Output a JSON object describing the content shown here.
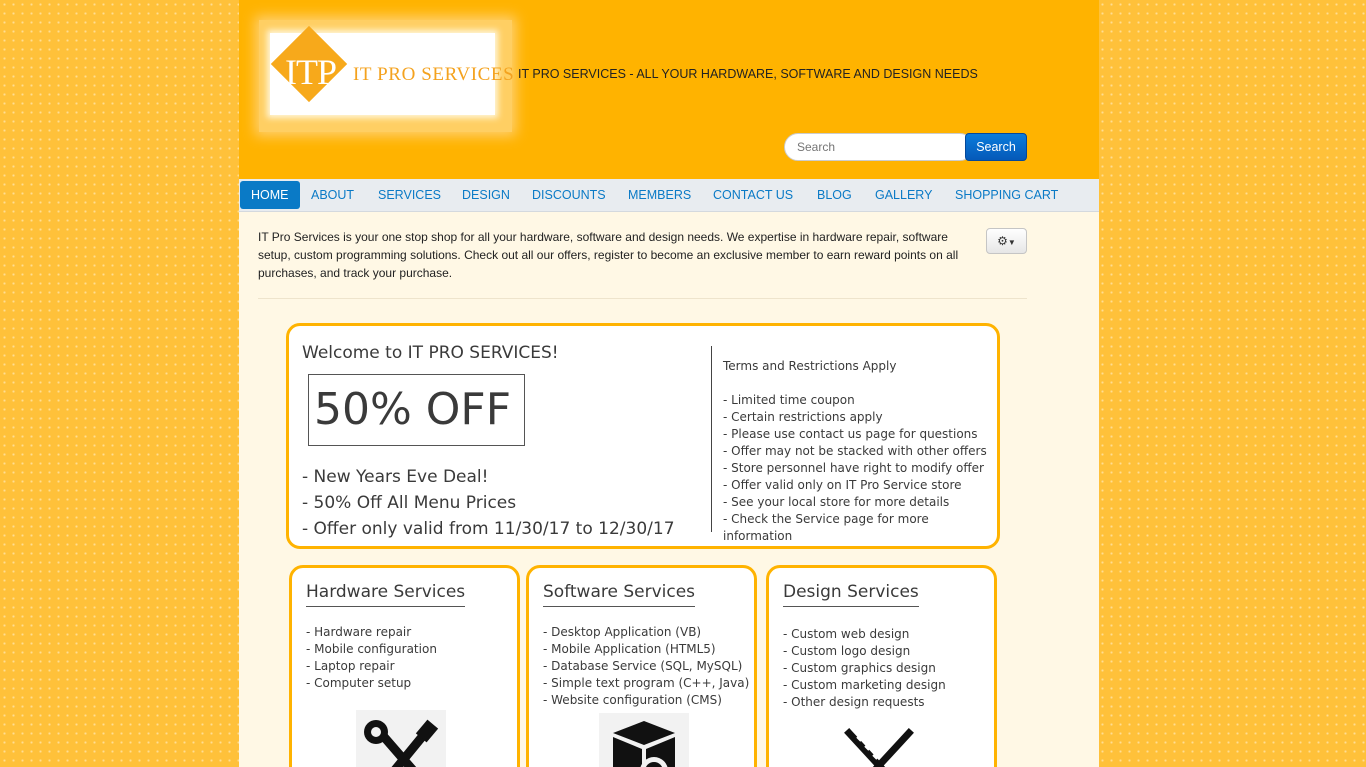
{
  "header": {
    "logo_itp": "ITP",
    "logo_name": "IT PRO SERVICES",
    "tagline": "IT PRO SERVICES - ALL YOUR HARDWARE, SOFTWARE AND DESIGN NEEDS",
    "search_placeholder": "Search",
    "search_button": "Search"
  },
  "nav": {
    "items": [
      {
        "label": "HOME",
        "active": true
      },
      {
        "label": "ABOUT"
      },
      {
        "label": "SERVICES"
      },
      {
        "label": "DESIGN"
      },
      {
        "label": "DISCOUNTS"
      },
      {
        "label": "MEMBERS"
      },
      {
        "label": "CONTACT US"
      },
      {
        "label": "BLOG"
      },
      {
        "label": "GALLERY"
      },
      {
        "label": "SHOPPING CART"
      }
    ]
  },
  "intro": {
    "text": "IT Pro Services is your one stop shop for all your hardware, software and design needs. We expertise in hardware repair, software setup, custom programming solutions. Check out all our offers, register to become an exclusive member to earn reward points on all purchases, and track your purchase.",
    "gear_icon": "gear-icon"
  },
  "promo": {
    "welcome": "Welcome to IT PRO SERVICES!",
    "discount": "50% OFF",
    "deal_lines": [
      "- New Years Eve Deal!",
      "- 50% Off All Menu Prices",
      "- Offer only valid from 11/30/17 to 12/30/17"
    ],
    "terms_title": "Terms and Restrictions Apply",
    "terms": [
      "- Limited time coupon",
      "- Certain restrictions apply",
      "- Please use contact us page for questions",
      "- Offer may not be stacked with other offers",
      "- Store personnel have right to modify offer",
      "- Offer valid only on IT Pro Service store",
      "- See your local store for more details",
      "- Check the Service page for more information"
    ]
  },
  "services": [
    {
      "title": "Hardware Services",
      "items": [
        "- Hardware repair",
        "- Mobile configuration",
        "- Laptop repair",
        "- Computer setup"
      ],
      "icon": "tools-icon"
    },
    {
      "title": "Software Services",
      "items": [
        "- Desktop Application (VB)",
        "- Mobile Application (HTML5)",
        "- Database Service (SQL, MySQL)",
        "- Simple text program (C++, Java)",
        "- Website configuration (CMS)"
      ],
      "icon": "software-box-icon"
    },
    {
      "title": "Design Services",
      "items": [
        "- Custom web design",
        "- Custom logo design",
        "- Custom graphics design",
        "- Custom marketing design",
        "- Other design requests"
      ],
      "icon": "design-ruler-icon"
    }
  ],
  "colors": {
    "header_bg": "#ffb300",
    "page_bg": "#fff8e5",
    "link": "#0a7ac6",
    "search_button": "#0a6ccf",
    "accent_border": "#ffb300"
  }
}
